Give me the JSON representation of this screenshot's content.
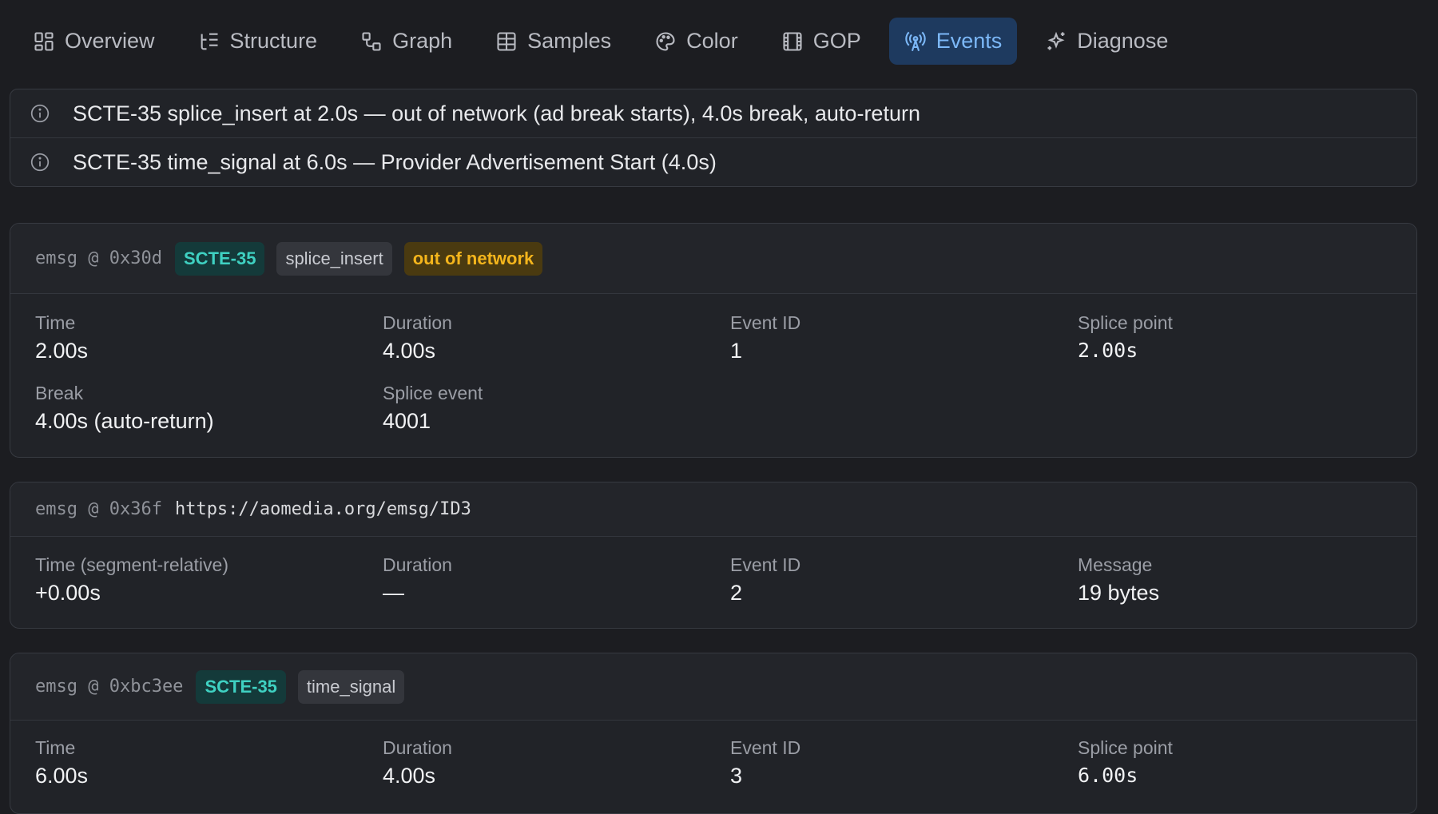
{
  "tabs": [
    {
      "label": "Overview",
      "icon": "grid-icon",
      "active": false
    },
    {
      "label": "Structure",
      "icon": "list-tree-icon",
      "active": false
    },
    {
      "label": "Graph",
      "icon": "graph-icon",
      "active": false
    },
    {
      "label": "Samples",
      "icon": "table-icon",
      "active": false
    },
    {
      "label": "Color",
      "icon": "palette-icon",
      "active": false
    },
    {
      "label": "GOP",
      "icon": "film-icon",
      "active": false
    },
    {
      "label": "Events",
      "icon": "broadcast-icon",
      "active": true
    },
    {
      "label": "Diagnose",
      "icon": "sparkles-icon",
      "active": false
    }
  ],
  "notices": [
    {
      "icon": "info-icon",
      "text": "SCTE-35 splice_insert at 2.0s — out of network (ad break starts), 4.0s break, auto-return"
    },
    {
      "icon": "info-icon",
      "text": "SCTE-35 time_signal at 6.0s — Provider Advertisement Start (4.0s)"
    }
  ],
  "events": [
    {
      "addr": "emsg @ 0x30d",
      "badges": {
        "scheme": "SCTE-35",
        "command": "splice_insert",
        "status": "out of network"
      },
      "fields": {
        "time": {
          "label": "Time",
          "value": "2.00s"
        },
        "duration": {
          "label": "Duration",
          "value": "4.00s"
        },
        "event_id": {
          "label": "Event ID",
          "value": "1"
        },
        "splice_point": {
          "label": "Splice point",
          "value": "2.00s"
        },
        "break": {
          "label": "Break",
          "value": "4.00s (auto-return)"
        },
        "splice_event": {
          "label": "Splice event",
          "value": "4001"
        }
      }
    },
    {
      "addr": "emsg @ 0x36f",
      "scheme_uri": "https://aomedia.org/emsg/ID3",
      "fields": {
        "time": {
          "label": "Time (segment-relative)",
          "value": "+0.00s"
        },
        "duration": {
          "label": "Duration",
          "value": "—"
        },
        "event_id": {
          "label": "Event ID",
          "value": "2"
        },
        "message": {
          "label": "Message",
          "value": "19 bytes"
        }
      }
    },
    {
      "addr": "emsg @ 0xbc3ee",
      "badges": {
        "scheme": "SCTE-35",
        "command": "time_signal"
      },
      "fields": {
        "time": {
          "label": "Time",
          "value": "6.00s"
        },
        "duration": {
          "label": "Duration",
          "value": "4.00s"
        },
        "event_id": {
          "label": "Event ID",
          "value": "3"
        },
        "splice_point": {
          "label": "Splice point",
          "value": "6.00s"
        }
      }
    }
  ],
  "colors": {
    "background": "#1c1d21",
    "accent": "#7cb8f8",
    "active_tab_bg": "#1e3a5f",
    "scte_badge": "#3fd1c2",
    "status_badge": "#f4b51c"
  }
}
